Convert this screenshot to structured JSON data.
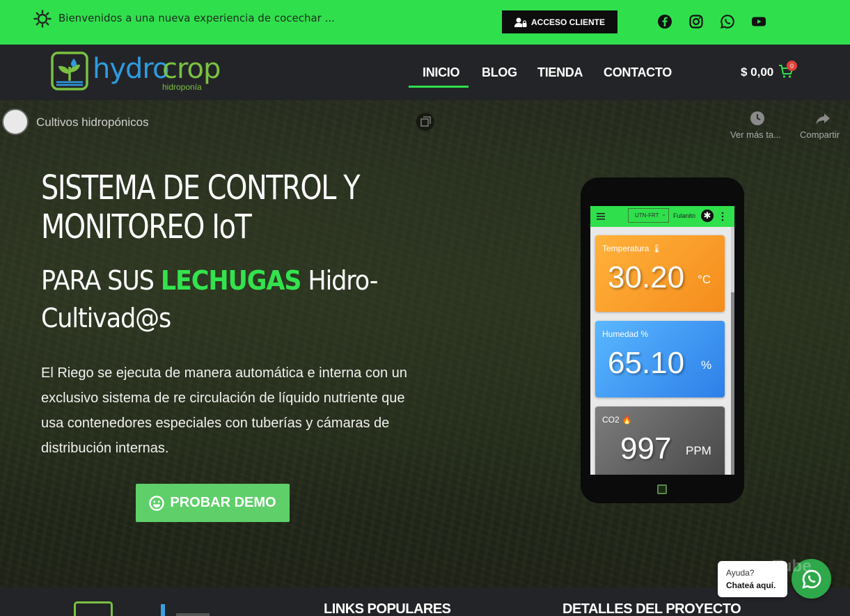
{
  "topbar": {
    "welcome": "Bienvenidos a una nueva experiencia de cocechar ...",
    "access_button": "ACCESO CLIENTE",
    "social_icons": [
      "facebook-icon",
      "instagram-icon",
      "whatsapp-icon",
      "youtube-icon"
    ]
  },
  "header": {
    "logo_word1": "hydro",
    "logo_word2": "crop",
    "logo_sub": "hidroponía",
    "nav": [
      "INICIO",
      "BLOG",
      "TIENDA",
      "CONTACTO"
    ],
    "active_nav": "INICIO",
    "cart_total": "$ 0,00",
    "cart_count": "0"
  },
  "video": {
    "channel_title": "Cultivos hidropónicos",
    "watch_later": "Ver más ta...",
    "share": "Compartir",
    "watermark": "Tube"
  },
  "hero": {
    "title_line1": "SISTEMA DE CONTROL Y",
    "title_line2": "MONITOREO IoT",
    "subtitle_pre": "PARA SUS ",
    "subtitle_accent": "LECHUGAS",
    "subtitle_post": " Hidro-",
    "subtitle_line2": "Cultivad@s",
    "paragraph": "El Riego se ejecuta de manera automática e interna con un exclusivo sistema de re circulación de líquido nutriente que usa contenedores especiales con tuberías y cámaras de distribución internas.",
    "demo_button": "PROBAR DEMO"
  },
  "phone_app": {
    "location": "UTN-FRT",
    "user": "Fulanito",
    "cards": [
      {
        "label": "Temperatura",
        "value": "30.20",
        "unit": "°C"
      },
      {
        "label": "Humedad %",
        "value": "65.10",
        "unit": "%"
      },
      {
        "label": "CO2",
        "value": "997",
        "unit": "PPM"
      }
    ]
  },
  "footer": {
    "links_heading": "LINKS POPULARES",
    "details_heading": "DETALLES DEL PROYECTO"
  },
  "chat": {
    "line1": "Ayuda?",
    "line2": "Chateá aquí."
  },
  "colors": {
    "accent_green": "#2fe04c",
    "header_bg": "#232427",
    "demo_button": "#5fcf6a"
  }
}
